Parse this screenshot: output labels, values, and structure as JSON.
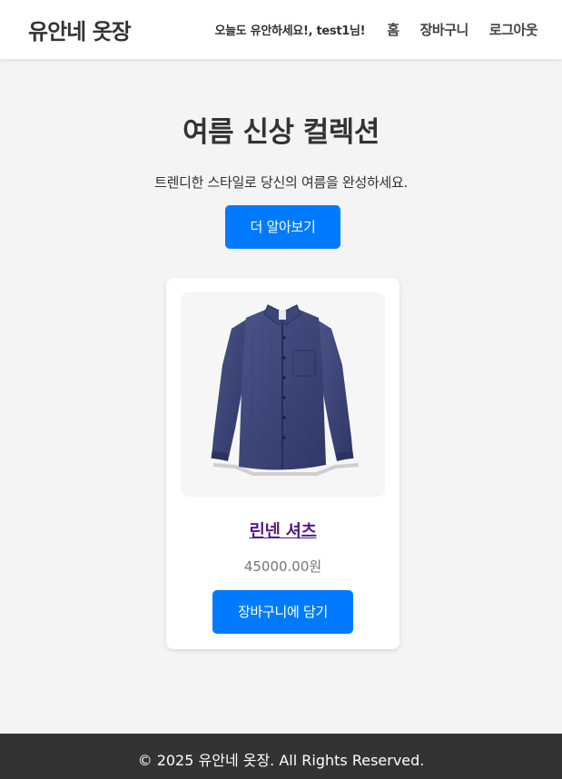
{
  "header": {
    "logo": "유안네 옷장",
    "greeting": "오늘도 유안하세요!, test1님!",
    "nav": [
      "홈",
      "장바구니",
      "로그아웃"
    ]
  },
  "hero": {
    "title": "여름 신상 컬렉션",
    "subtitle": "트렌디한 스타일로 당신의 여름을 완성하세요.",
    "button": "더 알아보기"
  },
  "product": {
    "name": "린넨 셔츠",
    "price": "45000.00원",
    "button": "장바구니에 담기",
    "image": "navy-linen-shirt"
  },
  "footer": {
    "text": "© 2025 유안네 옷장. All Rights Reserved."
  },
  "colors": {
    "primary": "#007bff",
    "link_visited": "#551a8b",
    "footer_bg": "#333333",
    "page_bg": "#f4f4f4"
  }
}
